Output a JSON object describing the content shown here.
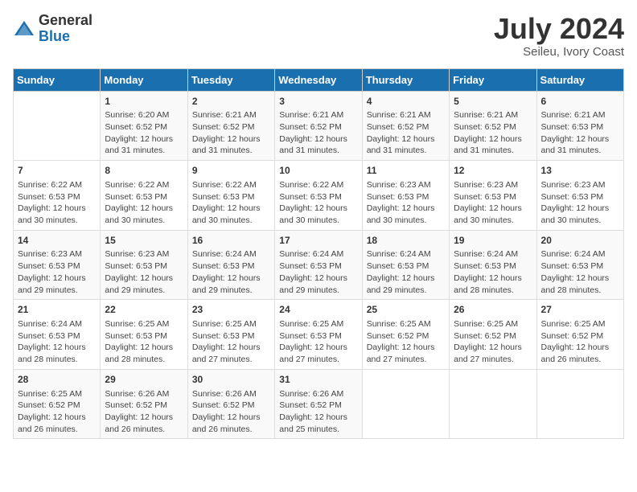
{
  "header": {
    "logo_general": "General",
    "logo_blue": "Blue",
    "month_year": "July 2024",
    "location": "Seileu, Ivory Coast"
  },
  "days_of_week": [
    "Sunday",
    "Monday",
    "Tuesday",
    "Wednesday",
    "Thursday",
    "Friday",
    "Saturday"
  ],
  "weeks": [
    [
      {
        "day": "",
        "info": ""
      },
      {
        "day": "1",
        "info": "Sunrise: 6:20 AM\nSunset: 6:52 PM\nDaylight: 12 hours\nand 31 minutes."
      },
      {
        "day": "2",
        "info": "Sunrise: 6:21 AM\nSunset: 6:52 PM\nDaylight: 12 hours\nand 31 minutes."
      },
      {
        "day": "3",
        "info": "Sunrise: 6:21 AM\nSunset: 6:52 PM\nDaylight: 12 hours\nand 31 minutes."
      },
      {
        "day": "4",
        "info": "Sunrise: 6:21 AM\nSunset: 6:52 PM\nDaylight: 12 hours\nand 31 minutes."
      },
      {
        "day": "5",
        "info": "Sunrise: 6:21 AM\nSunset: 6:52 PM\nDaylight: 12 hours\nand 31 minutes."
      },
      {
        "day": "6",
        "info": "Sunrise: 6:21 AM\nSunset: 6:53 PM\nDaylight: 12 hours\nand 31 minutes."
      }
    ],
    [
      {
        "day": "7",
        "info": "Sunrise: 6:22 AM\nSunset: 6:53 PM\nDaylight: 12 hours\nand 30 minutes."
      },
      {
        "day": "8",
        "info": "Sunrise: 6:22 AM\nSunset: 6:53 PM\nDaylight: 12 hours\nand 30 minutes."
      },
      {
        "day": "9",
        "info": "Sunrise: 6:22 AM\nSunset: 6:53 PM\nDaylight: 12 hours\nand 30 minutes."
      },
      {
        "day": "10",
        "info": "Sunrise: 6:22 AM\nSunset: 6:53 PM\nDaylight: 12 hours\nand 30 minutes."
      },
      {
        "day": "11",
        "info": "Sunrise: 6:23 AM\nSunset: 6:53 PM\nDaylight: 12 hours\nand 30 minutes."
      },
      {
        "day": "12",
        "info": "Sunrise: 6:23 AM\nSunset: 6:53 PM\nDaylight: 12 hours\nand 30 minutes."
      },
      {
        "day": "13",
        "info": "Sunrise: 6:23 AM\nSunset: 6:53 PM\nDaylight: 12 hours\nand 30 minutes."
      }
    ],
    [
      {
        "day": "14",
        "info": "Sunrise: 6:23 AM\nSunset: 6:53 PM\nDaylight: 12 hours\nand 29 minutes."
      },
      {
        "day": "15",
        "info": "Sunrise: 6:23 AM\nSunset: 6:53 PM\nDaylight: 12 hours\nand 29 minutes."
      },
      {
        "day": "16",
        "info": "Sunrise: 6:24 AM\nSunset: 6:53 PM\nDaylight: 12 hours\nand 29 minutes."
      },
      {
        "day": "17",
        "info": "Sunrise: 6:24 AM\nSunset: 6:53 PM\nDaylight: 12 hours\nand 29 minutes."
      },
      {
        "day": "18",
        "info": "Sunrise: 6:24 AM\nSunset: 6:53 PM\nDaylight: 12 hours\nand 29 minutes."
      },
      {
        "day": "19",
        "info": "Sunrise: 6:24 AM\nSunset: 6:53 PM\nDaylight: 12 hours\nand 28 minutes."
      },
      {
        "day": "20",
        "info": "Sunrise: 6:24 AM\nSunset: 6:53 PM\nDaylight: 12 hours\nand 28 minutes."
      }
    ],
    [
      {
        "day": "21",
        "info": "Sunrise: 6:24 AM\nSunset: 6:53 PM\nDaylight: 12 hours\nand 28 minutes."
      },
      {
        "day": "22",
        "info": "Sunrise: 6:25 AM\nSunset: 6:53 PM\nDaylight: 12 hours\nand 28 minutes."
      },
      {
        "day": "23",
        "info": "Sunrise: 6:25 AM\nSunset: 6:53 PM\nDaylight: 12 hours\nand 27 minutes."
      },
      {
        "day": "24",
        "info": "Sunrise: 6:25 AM\nSunset: 6:53 PM\nDaylight: 12 hours\nand 27 minutes."
      },
      {
        "day": "25",
        "info": "Sunrise: 6:25 AM\nSunset: 6:52 PM\nDaylight: 12 hours\nand 27 minutes."
      },
      {
        "day": "26",
        "info": "Sunrise: 6:25 AM\nSunset: 6:52 PM\nDaylight: 12 hours\nand 27 minutes."
      },
      {
        "day": "27",
        "info": "Sunrise: 6:25 AM\nSunset: 6:52 PM\nDaylight: 12 hours\nand 26 minutes."
      }
    ],
    [
      {
        "day": "28",
        "info": "Sunrise: 6:25 AM\nSunset: 6:52 PM\nDaylight: 12 hours\nand 26 minutes."
      },
      {
        "day": "29",
        "info": "Sunrise: 6:26 AM\nSunset: 6:52 PM\nDaylight: 12 hours\nand 26 minutes."
      },
      {
        "day": "30",
        "info": "Sunrise: 6:26 AM\nSunset: 6:52 PM\nDaylight: 12 hours\nand 26 minutes."
      },
      {
        "day": "31",
        "info": "Sunrise: 6:26 AM\nSunset: 6:52 PM\nDaylight: 12 hours\nand 25 minutes."
      },
      {
        "day": "",
        "info": ""
      },
      {
        "day": "",
        "info": ""
      },
      {
        "day": "",
        "info": ""
      }
    ]
  ]
}
